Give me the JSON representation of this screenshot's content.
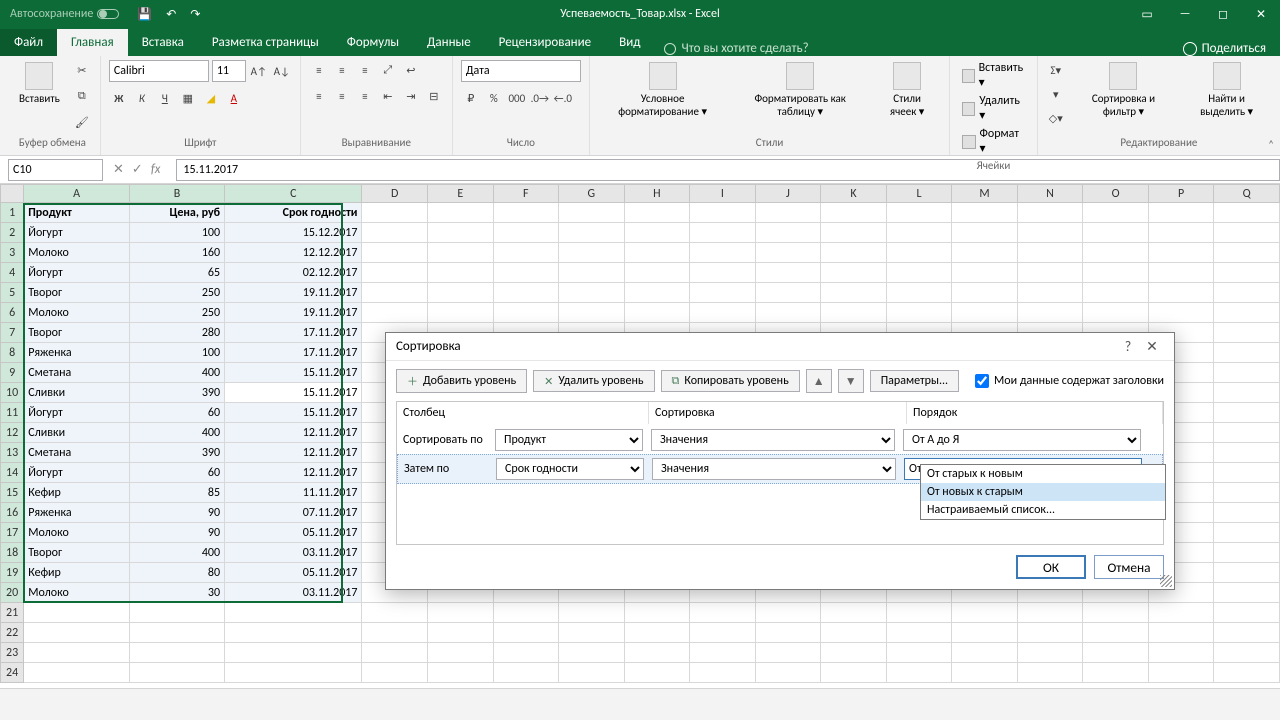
{
  "titlebar": {
    "autosave": "Автосохранение",
    "filename": "Успеваемость_Товар.xlsx  -  Excel"
  },
  "tabs": {
    "file": "Файл",
    "home": "Главная",
    "insert": "Вставка",
    "layout": "Разметка страницы",
    "formulas": "Формулы",
    "data": "Данные",
    "review": "Рецензирование",
    "view": "Вид",
    "tell_me": "Что вы хотите сделать?",
    "share": "Поделиться"
  },
  "ribbon": {
    "clipboard": {
      "label": "Буфер обмена",
      "paste": "Вставить"
    },
    "font": {
      "label": "Шрифт",
      "name": "Calibri",
      "size": "11"
    },
    "align": {
      "label": "Выравнивание"
    },
    "number": {
      "label": "Число",
      "format": "Дата"
    },
    "styles": {
      "label": "Стили",
      "cond": "Условное форматирование ▾",
      "table": "Форматировать как таблицу ▾",
      "cell": "Стили ячеек ▾"
    },
    "cells": {
      "label": "Ячейки",
      "insert": "Вставить ▾",
      "delete": "Удалить ▾",
      "format": "Формат ▾"
    },
    "editing": {
      "label": "Редактирование",
      "sort": "Сортировка и фильтр ▾",
      "find": "Найти и выделить ▾"
    }
  },
  "namebox": "C10",
  "formula": "15.11.2017",
  "columns": [
    "A",
    "B",
    "C",
    "D",
    "E",
    "F",
    "G",
    "H",
    "I",
    "J",
    "K",
    "L",
    "M",
    "N",
    "O",
    "P",
    "Q"
  ],
  "header_row": {
    "A": "Продукт",
    "B": "Цена, руб",
    "C": "Срок годности"
  },
  "rows": [
    {
      "n": 1,
      "A": "Продукт",
      "B": "Цена, руб",
      "C": "Срок годности",
      "bold": true
    },
    {
      "n": 2,
      "A": "Йогурт",
      "B": "100",
      "C": "15.12.2017"
    },
    {
      "n": 3,
      "A": "Молоко",
      "B": "160",
      "C": "12.12.2017"
    },
    {
      "n": 4,
      "A": "Йогурт",
      "B": "65",
      "C": "02.12.2017"
    },
    {
      "n": 5,
      "A": "Творог",
      "B": "250",
      "C": "19.11.2017"
    },
    {
      "n": 6,
      "A": "Молоко",
      "B": "250",
      "C": "19.11.2017"
    },
    {
      "n": 7,
      "A": "Творог",
      "B": "280",
      "C": "17.11.2017"
    },
    {
      "n": 8,
      "A": "Ряженка",
      "B": "100",
      "C": "17.11.2017"
    },
    {
      "n": 9,
      "A": "Сметана",
      "B": "400",
      "C": "15.11.2017"
    },
    {
      "n": 10,
      "A": "Сливки",
      "B": "390",
      "C": "15.11.2017",
      "active": true
    },
    {
      "n": 11,
      "A": "Йогурт",
      "B": "60",
      "C": "15.11.2017"
    },
    {
      "n": 12,
      "A": "Сливки",
      "B": "400",
      "C": "12.11.2017"
    },
    {
      "n": 13,
      "A": "Сметана",
      "B": "390",
      "C": "12.11.2017"
    },
    {
      "n": 14,
      "A": "Йогурт",
      "B": "60",
      "C": "12.11.2017"
    },
    {
      "n": 15,
      "A": "Кефир",
      "B": "85",
      "C": "11.11.2017"
    },
    {
      "n": 16,
      "A": "Ряженка",
      "B": "90",
      "C": "07.11.2017"
    },
    {
      "n": 17,
      "A": "Молоко",
      "B": "90",
      "C": "05.11.2017"
    },
    {
      "n": 18,
      "A": "Творог",
      "B": "400",
      "C": "03.11.2017"
    },
    {
      "n": 19,
      "A": "Кефир",
      "B": "80",
      "C": "05.11.2017"
    },
    {
      "n": 20,
      "A": "Молоко",
      "B": "30",
      "C": "03.11.2017"
    },
    {
      "n": 21
    },
    {
      "n": 22
    },
    {
      "n": 23
    },
    {
      "n": 24
    }
  ],
  "dialog": {
    "title": "Сортировка",
    "add": "Добавить уровень",
    "del": "Удалить уровень",
    "copy": "Копировать уровень",
    "params": "Параметры...",
    "headers": "Мои данные содержат заголовки",
    "col_h": "Столбец",
    "sort_h": "Сортировка",
    "order_h": "Порядок",
    "sort_by": "Сортировать по",
    "then_by": "Затем по",
    "lev1": {
      "col": "Продукт",
      "on": "Значения",
      "ord": "От А до Я"
    },
    "lev2": {
      "col": "Срок годности",
      "on": "Значения",
      "ord": "От старых к новым"
    },
    "dropdown": {
      "o1": "От старых к новым",
      "o2": "От новых к старым",
      "o3": "Настраиваемый список..."
    },
    "ok": "ОК",
    "cancel": "Отмена"
  }
}
